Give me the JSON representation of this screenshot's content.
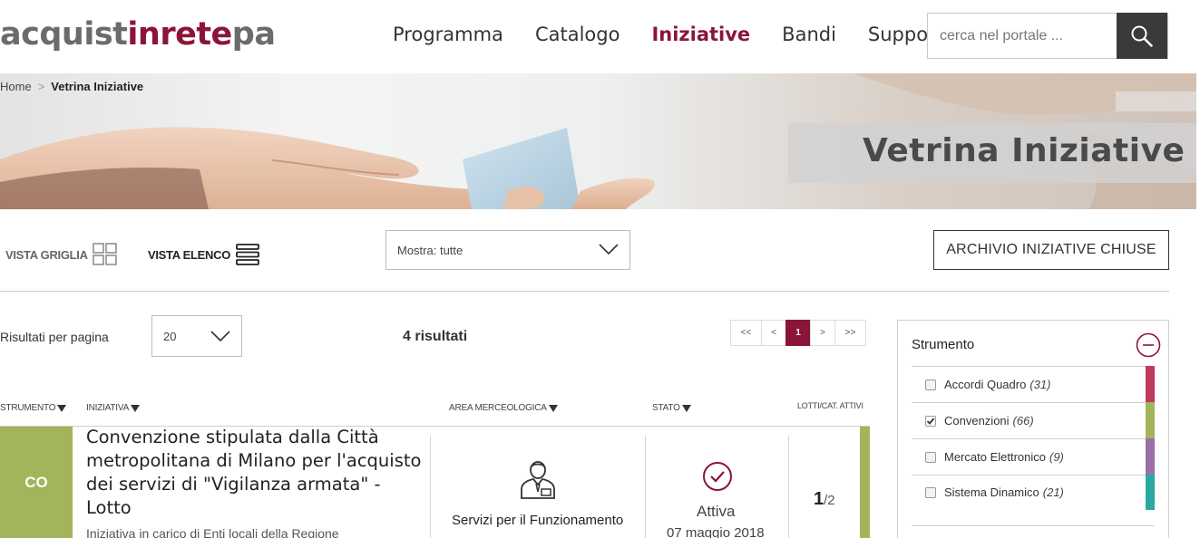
{
  "header": {
    "logo": {
      "part1": "acquist",
      "part2": "inrete",
      "part3": "pa"
    },
    "nav": [
      "Programma",
      "Catalogo",
      "Iniziative",
      "Bandi",
      "Supporto"
    ],
    "active_nav": "Iniziative",
    "search": {
      "placeholder": "cerca nel portale ...",
      "button_icon": "search-icon"
    }
  },
  "breadcrumb": {
    "home": "Home",
    "separator": ">",
    "current": "Vetrina Iniziative"
  },
  "hero": {
    "title": "Vetrina Iniziative"
  },
  "toolbar": {
    "grid_label": "VISTA GRIGLIA",
    "list_label": "VISTA ELENCO",
    "filter_select": "Mostra: tutte",
    "archive_button": "ARCHIVIO INIZIATIVE CHIUSE"
  },
  "results": {
    "per_page_label": "Risultati per pagina",
    "per_page_value": "20",
    "count": "4 risultati",
    "pagination": [
      "<<",
      "<",
      "1",
      ">",
      ">>"
    ],
    "current_page": "1"
  },
  "table": {
    "headers": {
      "strumento": "STRUMENTO",
      "iniziativa": "INIZIATIVA",
      "area": "AREA MERCEOLOGICA",
      "stato": "STATO",
      "lotti": "LOTTI/CAT. ATTIVI"
    },
    "rows": [
      {
        "badge": "CO",
        "title": "Convenzione stipulata dalla Città metropolitana di Milano per l'acquisto dei servizi di \"Vigilanza armata\" - Lotto",
        "subtitle": "Iniziativa in carico di Enti locali della Regione",
        "area": "Servizi per il Funzionamento",
        "stato": "Attiva",
        "date": "07 maggio 2018",
        "lotti_active": "1",
        "lotti_total": "/2",
        "color": "#a3b55a"
      }
    ]
  },
  "filter_panel": {
    "title": "Strumento",
    "options": [
      {
        "label": "Accordi Quadro",
        "count": "(31)",
        "checked": false,
        "color": "#c0395f"
      },
      {
        "label": "Convenzioni",
        "count": "(66)",
        "checked": true,
        "color": "#a3b55a"
      },
      {
        "label": "Mercato Elettronico",
        "count": "(9)",
        "checked": false,
        "color": "#9a70a8"
      },
      {
        "label": "Sistema Dinamico",
        "count": "(21)",
        "checked": false,
        "color": "#2aa9a3"
      }
    ]
  },
  "colors": {
    "brand": "#8a1538",
    "logo_grey": "#6b6b6b",
    "dark_button": "#3a3a3a"
  }
}
